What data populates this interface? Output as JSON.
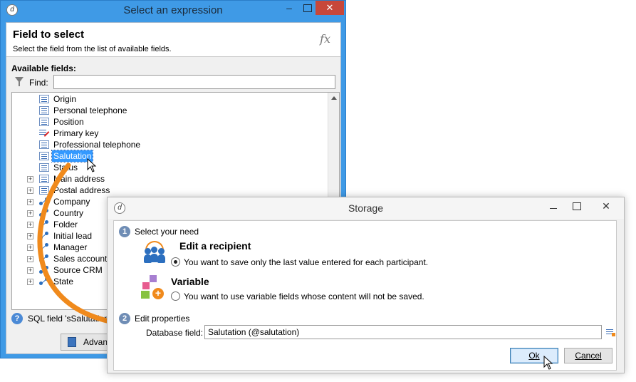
{
  "select_window": {
    "title": "Select an expression",
    "header_title": "Field to select",
    "header_subtitle": "Select the field from the list of available fields.",
    "fx_symbol": "fx",
    "available_label": "Available fields:",
    "find_label": "Find:",
    "find_value": "",
    "tree_items": [
      {
        "label": "Origin",
        "icon": "field-icon",
        "expandable": false
      },
      {
        "label": "Personal telephone",
        "icon": "field-icon",
        "expandable": false
      },
      {
        "label": "Position",
        "icon": "field-icon",
        "expandable": false
      },
      {
        "label": "Primary key",
        "icon": "primary-key-icon",
        "expandable": false
      },
      {
        "label": "Professional telephone",
        "icon": "field-icon",
        "expandable": false
      },
      {
        "label": "Salutation",
        "icon": "field-icon",
        "expandable": false,
        "selected": true
      },
      {
        "label": "Status",
        "icon": "field-icon",
        "expandable": false
      },
      {
        "label": "Main address",
        "icon": "field-icon",
        "expandable": true
      },
      {
        "label": "Postal address",
        "icon": "field-icon",
        "expandable": true
      },
      {
        "label": "Company",
        "icon": "link-icon",
        "expandable": true
      },
      {
        "label": "Country",
        "icon": "link-icon",
        "expandable": true
      },
      {
        "label": "Folder",
        "icon": "link-icon",
        "expandable": true
      },
      {
        "label": "Initial lead",
        "icon": "link-icon",
        "expandable": true
      },
      {
        "label": "Manager",
        "icon": "link-icon",
        "expandable": true
      },
      {
        "label": "Sales account",
        "icon": "link-icon",
        "expandable": true
      },
      {
        "label": "Source CRM",
        "icon": "link-icon",
        "expandable": true
      },
      {
        "label": "State",
        "icon": "link-icon",
        "expandable": true
      }
    ],
    "sql_text": "SQL field 'sSalutation",
    "advanced_button": "Advan",
    "window_close_glyph": "✕",
    "window_min_glyph": "–"
  },
  "storage_window": {
    "title": "Storage",
    "step1_num": "1",
    "step1_label": "Select your need",
    "opt_recipient_title": "Edit a recipient",
    "opt_recipient_desc": "You want to save only the last value entered for each participant.",
    "opt_recipient_checked": true,
    "opt_variable_title": "Variable",
    "opt_variable_desc": "You want to use variable fields whose content will not be saved.",
    "opt_variable_checked": false,
    "step2_num": "2",
    "step2_label": "Edit properties",
    "db_field_label": "Database field:",
    "db_field_value": "Salutation (@salutation)",
    "ok_button": "Ok",
    "cancel_button": "Cancel",
    "close_glyph": "✕"
  },
  "colors": {
    "title_bar_active": "#3f9ae6",
    "selection": "#3399ff",
    "arrow": "#f08a1c"
  }
}
